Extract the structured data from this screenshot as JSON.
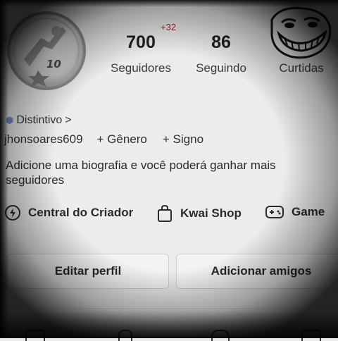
{
  "stats": {
    "followers": {
      "value": "700",
      "label": "Seguidores",
      "delta": "+32"
    },
    "following": {
      "value": "86",
      "label": "Seguindo"
    },
    "likes": {
      "label": "Curtidas"
    }
  },
  "profile": {
    "badge_label": "Distintivo",
    "badge_chevron": ">",
    "username": "jhonsoares609",
    "gender_action": "+ Gênero",
    "sign_action": "+ Signo",
    "bio_prompt": "Adicione uma biografia e você poderá ganhar mais seguidores",
    "medal_number": "10"
  },
  "tools": [
    {
      "label": "Central do Criador",
      "icon": "lightning-circle-icon"
    },
    {
      "label": "Kwai Shop",
      "icon": "shopping-bag-icon"
    },
    {
      "label": "Game",
      "icon": "gamepad-icon"
    }
  ],
  "buttons": {
    "edit_profile": "Editar perfil",
    "add_friends": "Adicionar amigos"
  },
  "colors": {
    "delta_red": "#b21e2a",
    "badge_blue": "#7a8fd4",
    "text_dark": "#1b1b1b"
  }
}
